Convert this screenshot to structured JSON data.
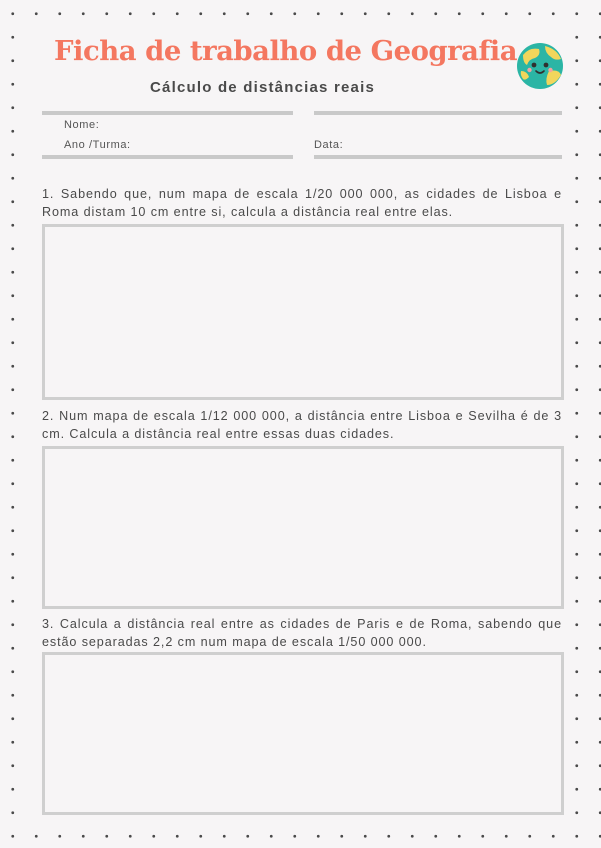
{
  "header": {
    "title": "Ficha de trabalho de Geografia",
    "subtitle": "Cálculo de distâncias reais"
  },
  "fields": {
    "name_label": "Nome:",
    "class_label": "Ano /Turma:",
    "date_label": "Data:"
  },
  "questions": [
    {
      "text": "1. Sabendo que, num mapa de escala 1/20 000 000, as cidades de Lisboa e Roma distam 10 cm entre si, calcula a distância real entre elas."
    },
    {
      "text": "2. Num mapa de escala 1/12 000 000, a distância entre Lisboa e Sevilha é de 3 cm. Calcula a distância real entre essas duas cidades."
    },
    {
      "text": "3. Calcula a distância real entre as cidades de Paris e de Roma, sabendo que estão separadas 2,2 cm num mapa de escala 1/50 000 000."
    }
  ],
  "colors": {
    "title": "#f47760",
    "background": "#f7f5f6",
    "lines": "#c9c9c9",
    "globe_ocean": "#2bb5a5",
    "globe_land": "#f2d65c"
  },
  "icons": {
    "globe": "smiling-earth-icon"
  }
}
